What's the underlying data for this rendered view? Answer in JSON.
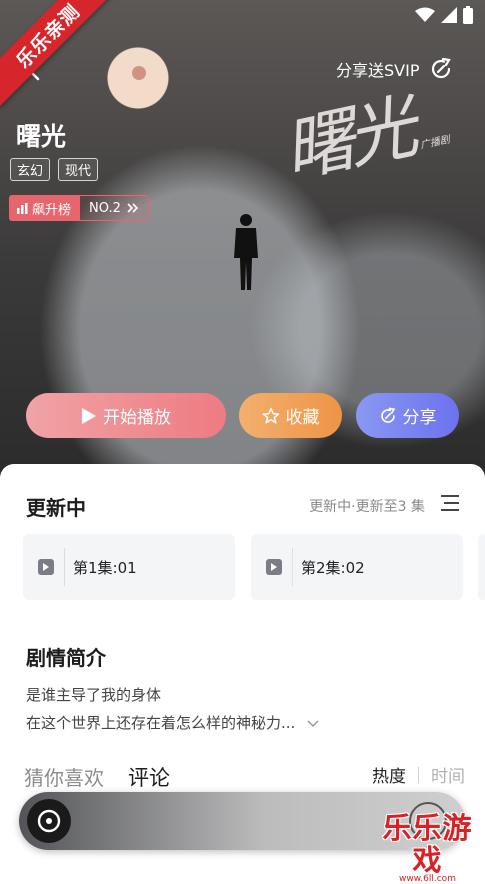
{
  "watermark": {
    "corner_label": "乐乐亲测",
    "brand_text": "乐乐游戏",
    "brand_url": "www.6ll.com"
  },
  "header": {
    "share_svip": "分享送SVIP"
  },
  "book": {
    "title": "曙光",
    "cover_art_title": "曙光",
    "cover_art_small": "广播剧",
    "tags": [
      "玄幻",
      "现代"
    ],
    "rank_label": "飙升榜",
    "rank_no": "NO.2"
  },
  "actions": {
    "play": "开始播放",
    "favorite": "收藏",
    "share": "分享"
  },
  "updating": {
    "title": "更新中",
    "info": "更新中·更新至3 集",
    "episodes": [
      "第1集:01",
      "第2集:02"
    ]
  },
  "synopsis": {
    "title": "剧情简介",
    "line1": "是谁主导了我的身体",
    "line2": "在这个世界上还存在着怎么样的神秘力..."
  },
  "tabs": {
    "recommend": "猜你喜欢",
    "comments": "评论"
  },
  "sort": {
    "hot": "热度",
    "time": "时间"
  },
  "colors": {
    "accent_red": "#e64d4d",
    "play": "#ee7b82",
    "fav": "#ee9445",
    "share": "#6c72ef"
  }
}
